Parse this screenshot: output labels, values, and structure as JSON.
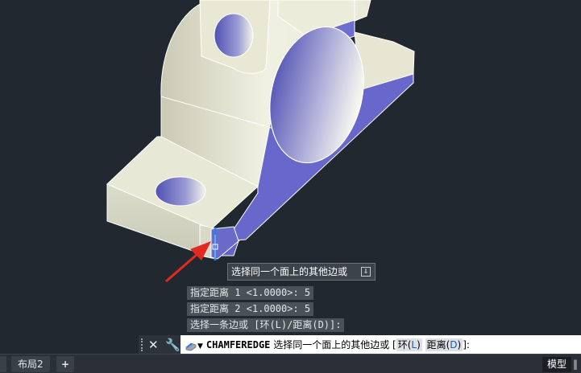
{
  "tooltip": {
    "text": "选择同一个面上的其他边或",
    "icon": "download-icon"
  },
  "history": {
    "line1": "指定距离 1 <1.0000>: 5",
    "line2": "指定距离 2 <1.0000>: 5",
    "line3": "选择一条边或 [环(L)/距离(D)]:"
  },
  "command": {
    "name": "CHAMFEREDGE",
    "prompt": " 选择同一个面上的其他边或 [",
    "opt1_label": "环(",
    "opt1_key": "L",
    "opt1_close": ")",
    "opt2_label": "距离(",
    "opt2_key": "D",
    "opt2_close": ")",
    "suffix": "]:"
  },
  "tabs": {
    "layout2": "布局2",
    "add": "+"
  },
  "status": {
    "model": "模型",
    "grid": "‖"
  },
  "colors": {
    "background": "#212830",
    "face_light": "#e3e3cf",
    "face_side": "#6464c8",
    "arrow": "#e32a22",
    "selected_edge": "#2f7fe8"
  }
}
